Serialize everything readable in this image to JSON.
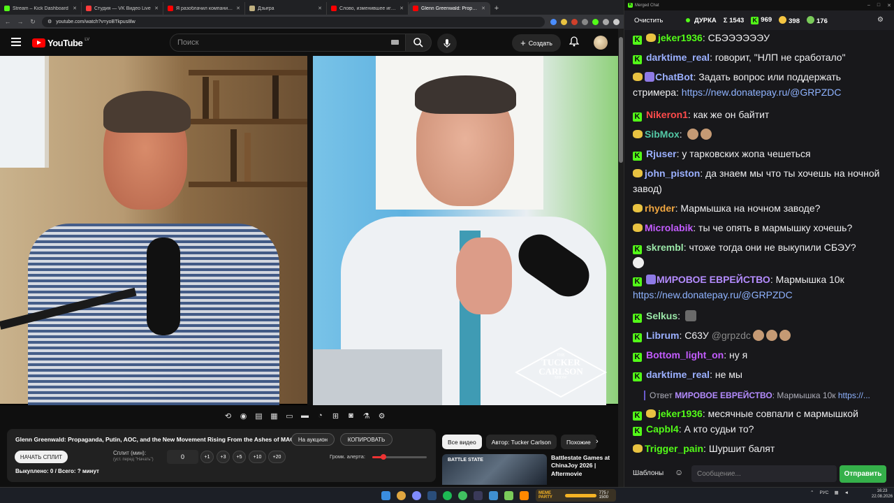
{
  "browser": {
    "tabs": [
      {
        "title": "Stream – Kick Dashboard",
        "color": "#53fc18",
        "active": false
      },
      {
        "title": "Студия — VK Видео Live",
        "color": "#ff3b3b",
        "active": false
      },
      {
        "title": "Я разоблачил компанию, кот",
        "color": "#ff0000",
        "active": false
      },
      {
        "title": "Дзығра",
        "color": "#c0b080",
        "active": false
      },
      {
        "title": "Слово, изменившее игровую",
        "color": "#ff0000",
        "active": false
      },
      {
        "title": "Glenn Greenwald: Propaga",
        "color": "#ff0000",
        "active": true
      }
    ],
    "url": "youtube.com/watch?v=yoBTkpus8lw"
  },
  "youtube": {
    "logo_text": "YouTube",
    "country": "LV",
    "search_placeholder": "Поиск",
    "create_label": "Создать"
  },
  "video": {
    "overlay_logo": {
      "line1": "THE",
      "line2": "TUCKER",
      "line3": "CARLSON",
      "line4": "SHOW"
    },
    "title": "Glenn Greenwald: Propaganda, Putin, AOC, and the New Movement Rising From the Ashes of MAGA",
    "auction_label": "На аукцион",
    "copy_label": "КОПИРОВАТЬ",
    "split_button": "НАЧАТЬ СПЛИТ",
    "split_label": "Сплит (мин):",
    "split_hint": "(уст. перед \"Начать\")",
    "split_value": "0",
    "increments": [
      "+1",
      "+3",
      "+5",
      "+10",
      "+20"
    ],
    "alert_volume_label": "Громк. алерта:",
    "alert_volume": 0.2,
    "bought_text": "Выкуплено: 0 / Всего: ? минут"
  },
  "chips": [
    "Все видео",
    "Автор: Tucker Carlson",
    "Похожие"
  ],
  "recommendation": {
    "thumb_text": "BATTLE STATE",
    "title": "Battlestate Games at ChinaJoy 2026 | Aftermovie"
  },
  "taskbar": {
    "meme_label": "MEME PARTY",
    "meme_progress": "775 / 1500",
    "lang": "РУС",
    "time": "16:23",
    "date": "22.08.2026"
  },
  "chat": {
    "window_title": "Merged Chat",
    "clear_label": "Очистить",
    "channel": "ДУРКА",
    "sum": "Σ 1543",
    "kick_count": "969",
    "vk_count": "398",
    "other_count": "176",
    "messages": [
      {
        "badge": "kick-vip",
        "user": "jeker1936",
        "color": "#53fc18",
        "text": "СБЭЭЭЭЭЭУ"
      },
      {
        "badge": "kick",
        "user": "darktime_real",
        "color": "#9bb0ff",
        "text": "говорит, \"НЛП не сработало\""
      },
      {
        "badge": "vk-bot",
        "user": "ChatBot",
        "color": "#9bb0ff",
        "text": "Задать вопрос или поддержать стримера: ",
        "link": "https://new.donatepay.ru/@GRPZDC"
      },
      {
        "badge": "kick",
        "user": "Nikeron1",
        "color": "#ff4b4b",
        "text": "как же он байтит"
      },
      {
        "badge": "vk",
        "user": "SibMox",
        "color": "#53c8a6",
        "text": ""
      },
      {
        "badge": "kick",
        "user": "Rjuser",
        "color": "#9bb0ff",
        "text": "у тарковских жопа чешеться"
      },
      {
        "badge": "vk",
        "user": "john_piston",
        "color": "#9bb0ff",
        "text": "да знаем мы что ты хочешь на ночной завод)"
      },
      {
        "badge": "vk",
        "user": "rhyder",
        "color": "#f0a640",
        "text": "Мармышка на ночном заводе?"
      },
      {
        "badge": "vk",
        "user": "Microlabik",
        "color": "#c35cff",
        "text": "ты че опять в мармышку хочешь?"
      },
      {
        "badge": "kick",
        "user": "skrembl",
        "color": "#9ae6a8",
        "text": "чтоже тогда они не выкупили СБЭУ?"
      },
      {
        "badge": "kick-arrow",
        "user": "МИРОВОЕ ЕВРЕЙСТВО",
        "color": "#b48cff",
        "text": "Мармышка 10к ",
        "link": "https://new.donatepay.ru/@GRPZDC"
      },
      {
        "badge": "kick",
        "user": "Selkus",
        "color": "#9ae6a8",
        "text": ""
      },
      {
        "badge": "kick",
        "user": "Librum",
        "color": "#9bb0ff",
        "text": "С63У ",
        "mention": "@grpzdc"
      },
      {
        "badge": "kick",
        "user": "Bottom_light_on",
        "color": "#c35cff",
        "text": "ну я"
      },
      {
        "badge": "kick",
        "user": "darktime_real",
        "color": "#9bb0ff",
        "text": "не мы"
      },
      {
        "badge": "kick-vip",
        "user": "jeker1936",
        "color": "#53fc18",
        "text": "месячные совпали с мармышкой"
      },
      {
        "badge": "kick",
        "user": "Capbl4",
        "color": "#53fc18",
        "text": "А кто судьи то?"
      },
      {
        "badge": "vk",
        "user": "Trigger_pain",
        "color": "#53fc18",
        "text": "Шуршит балят"
      }
    ],
    "reply": {
      "prefix": "Ответ ",
      "user": "МИРОВОЕ ЕВРЕЙСТВО",
      "text": "Мармышка 10к ",
      "link": "https://..."
    },
    "templates_label": "Шаблоны",
    "input_placeholder": "Сообщение...",
    "send_label": "Отправить"
  }
}
